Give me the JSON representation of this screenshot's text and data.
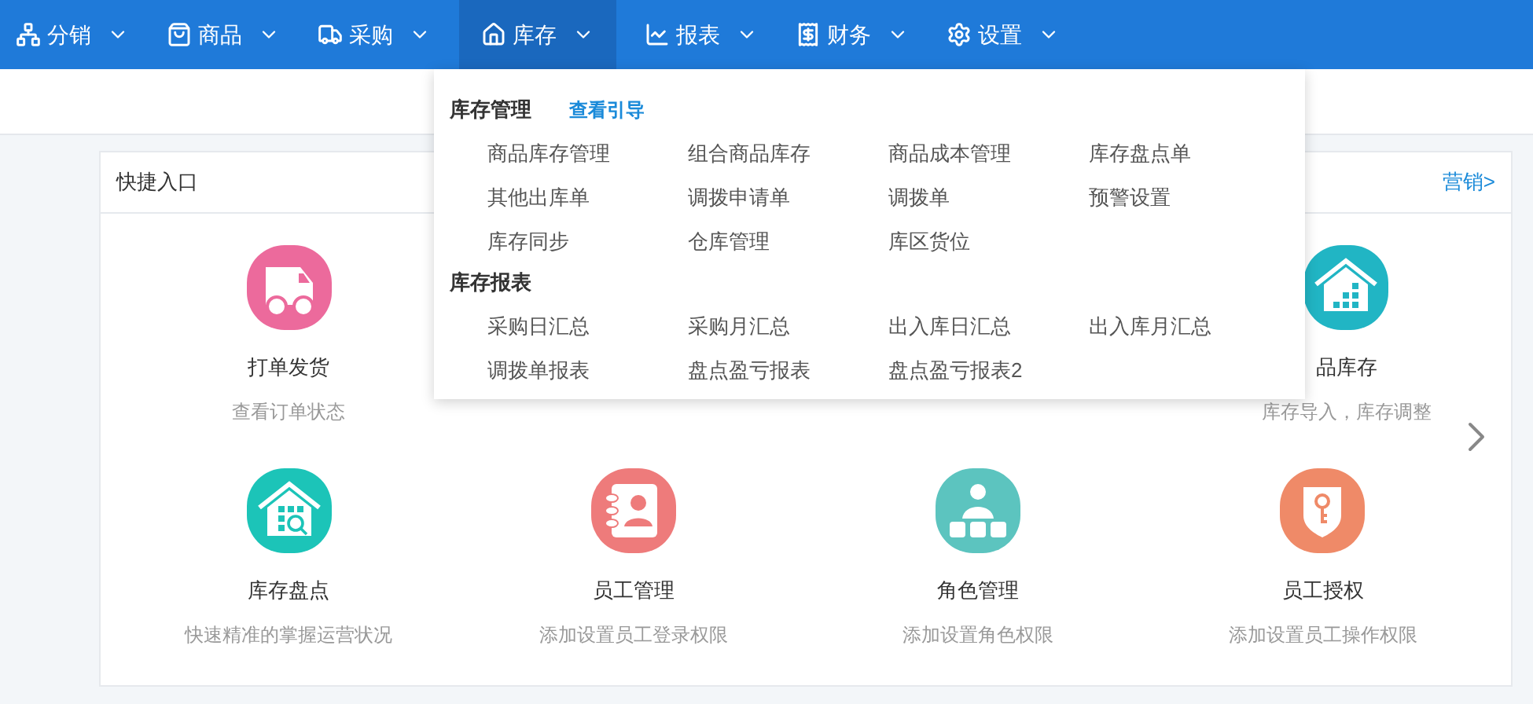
{
  "nav": [
    {
      "label": "分销",
      "selected": false
    },
    {
      "label": "商品",
      "selected": false
    },
    {
      "label": "采购",
      "selected": false
    },
    {
      "label": "库存",
      "selected": true
    },
    {
      "label": "报表",
      "selected": false
    },
    {
      "label": "财务",
      "selected": false
    },
    {
      "label": "设置",
      "selected": false
    }
  ],
  "dropdown": {
    "sections": [
      {
        "title": "库存管理",
        "link": "查看引导",
        "items": [
          "商品库存管理",
          "组合商品库存",
          "商品成本管理",
          "库存盘点单",
          "其他出库单",
          "调拨申请单",
          "调拨单",
          "预警设置",
          "库存同步",
          "仓库管理",
          "库区货位"
        ]
      },
      {
        "title": "库存报表",
        "items": [
          "采购日汇总",
          "采购月汇总",
          "出入库日汇总",
          "出入库月汇总",
          "调拨单报表",
          "盘点盈亏报表",
          "盘点盈亏报表2"
        ]
      }
    ]
  },
  "quick_entry": {
    "title": "快捷入口",
    "link": "营销>",
    "rows": [
      [
        {
          "title": "打单发货",
          "subtitle": "查看订单状态"
        },
        "",
        "",
        {
          "title": "品库存",
          "subtitle": "库存导入，库存调整"
        }
      ],
      [
        {
          "title": "库存盘点",
          "subtitle": "快速精准的掌握运营状况"
        },
        {
          "title": "员工管理",
          "subtitle": "添加设置员工登录权限"
        },
        {
          "title": "角色管理",
          "subtitle": "添加设置角色权限"
        },
        {
          "title": "员工授权",
          "subtitle": "添加设置员工操作权限"
        }
      ]
    ]
  }
}
